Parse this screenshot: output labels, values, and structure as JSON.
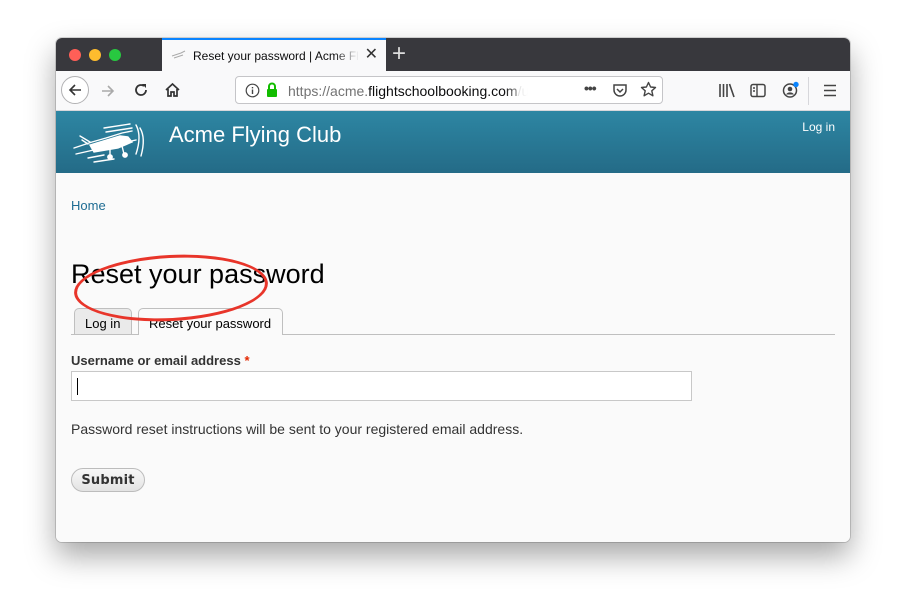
{
  "browser": {
    "tab": {
      "title": "Reset your password | Acme Flying Club",
      "favicon": "airplane-icon",
      "close_icon": "close-icon"
    },
    "new_tab_icon": "plus-icon",
    "nav": {
      "back_icon": "arrow-left-icon",
      "forward_icon": "arrow-right-icon",
      "reload_icon": "reload-icon",
      "home_icon": "home-icon"
    },
    "url": {
      "scheme": "https://",
      "subdomain": "acme.",
      "domain": "flightschoolbooking.com",
      "path": "/user/password"
    },
    "toolbar_icons": [
      "info-icon",
      "lock-icon",
      "more-icon",
      "pocket-icon",
      "star-icon",
      "library-icon",
      "sidebar-icon",
      "account-icon",
      "menu-icon"
    ],
    "accent_color": "#0a84ff"
  },
  "site": {
    "name": "Acme Flying Club",
    "header_login": "Log in",
    "header_color": "#2d86a3"
  },
  "page": {
    "breadcrumb": "Home",
    "title": "Reset your password",
    "tabs": [
      {
        "label": "Log in",
        "active": false
      },
      {
        "label": "Reset your password",
        "active": true
      }
    ],
    "form": {
      "field_label": "Username or email address",
      "required_marker": "*",
      "field_value": "",
      "help_text": "Password reset instructions will be sent to your registered email address.",
      "submit_label": "Submit"
    }
  },
  "annotation": {
    "type": "ellipse",
    "target": "Reset your password tab",
    "color": "#e8352a"
  }
}
